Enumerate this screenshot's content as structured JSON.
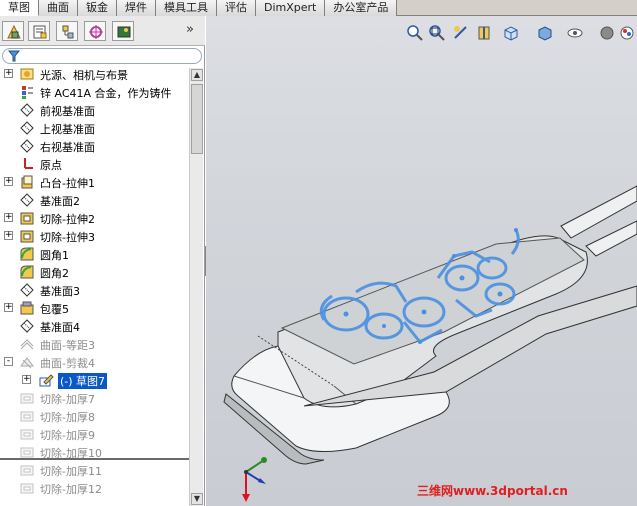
{
  "command_tabs": [
    "草图",
    "曲面",
    "钣金",
    "焊件",
    "模具工具",
    "评估",
    "DimXpert",
    "办公室产品"
  ],
  "active_tab": 0,
  "panel_toolbar": {
    "icons": [
      "feature-manager-icon",
      "property-manager-icon",
      "configuration-manager-icon",
      "dimxpert-manager-icon",
      "display-manager-icon"
    ],
    "more": "»"
  },
  "tree": [
    {
      "label": "光源、相机与布景",
      "icon": "lights-icon",
      "expander": "+",
      "state": "normal"
    },
    {
      "label": "锌 AC41A 合金，作为铸件",
      "icon": "material-icon",
      "expander": "",
      "state": "normal"
    },
    {
      "label": "前视基准面",
      "icon": "plane-icon",
      "expander": "",
      "state": "normal"
    },
    {
      "label": "上视基准面",
      "icon": "plane-icon",
      "expander": "",
      "state": "normal"
    },
    {
      "label": "右视基准面",
      "icon": "plane-icon",
      "expander": "",
      "state": "normal"
    },
    {
      "label": "原点",
      "icon": "origin-icon",
      "expander": "",
      "state": "normal"
    },
    {
      "label": "凸台-拉伸1",
      "icon": "extrude-icon",
      "expander": "+",
      "state": "normal"
    },
    {
      "label": "基准面2",
      "icon": "plane-icon",
      "expander": "",
      "state": "normal"
    },
    {
      "label": "切除-拉伸2",
      "icon": "cut-icon",
      "expander": "+",
      "state": "normal"
    },
    {
      "label": "切除-拉伸3",
      "icon": "cut-icon",
      "expander": "+",
      "state": "normal"
    },
    {
      "label": "圆角1",
      "icon": "fillet-icon",
      "expander": "",
      "state": "normal"
    },
    {
      "label": "圆角2",
      "icon": "fillet-icon",
      "expander": "",
      "state": "normal"
    },
    {
      "label": "基准面3",
      "icon": "plane-icon",
      "expander": "",
      "state": "normal"
    },
    {
      "label": "包覆5",
      "icon": "wrap-icon",
      "expander": "+",
      "state": "normal"
    },
    {
      "label": "基准面4",
      "icon": "plane-icon",
      "expander": "",
      "state": "normal"
    },
    {
      "label": "曲面-等距3",
      "icon": "offset-surface-icon",
      "expander": "",
      "state": "gray"
    },
    {
      "label": "曲面-剪裁4",
      "icon": "trim-surface-icon",
      "expander": "-",
      "state": "gray"
    },
    {
      "label": "(-) 草图7",
      "icon": "sketch-icon",
      "expander": "+",
      "state": "selected",
      "indent": true
    },
    {
      "label": "切除-加厚7",
      "icon": "thicken-cut-icon",
      "expander": "",
      "state": "gray"
    },
    {
      "label": "切除-加厚8",
      "icon": "thicken-cut-icon",
      "expander": "",
      "state": "gray"
    },
    {
      "label": "切除-加厚9",
      "icon": "thicken-cut-icon",
      "expander": "",
      "state": "gray"
    },
    {
      "label": "切除-加厚10",
      "icon": "thicken-cut-icon",
      "expander": "",
      "state": "gray"
    },
    {
      "label": "切除-加厚11",
      "icon": "thicken-cut-icon",
      "expander": "",
      "state": "gray"
    },
    {
      "label": "切除-加厚12",
      "icon": "thicken-cut-icon",
      "expander": "",
      "state": "gray"
    }
  ],
  "view_toolbar": [
    "zoom-to-fit-icon",
    "zoom-to-area-icon",
    "previous-view-icon",
    "section-view-icon",
    "view-orientation-icon",
    "display-style-icon",
    "hide-show-items-icon",
    "edit-appearance-icon",
    "apply-scene-icon"
  ],
  "watermark": "三维网www.3dportal.cn",
  "colors": {
    "accent": "#0a58c6",
    "sketch": "#4a90e2",
    "watermark": "#e02020"
  }
}
